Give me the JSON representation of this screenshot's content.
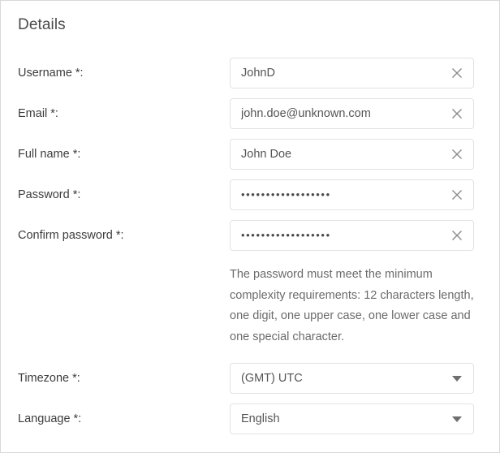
{
  "panel": {
    "title": "Details"
  },
  "form": {
    "fields": [
      {
        "label": "Username *:",
        "type": "text",
        "value": "JohnD",
        "clear_icon": "close-icon"
      },
      {
        "label": "Email *:",
        "type": "text",
        "value": "john.doe@unknown.com",
        "clear_icon": "close-icon"
      },
      {
        "label": "Full name *:",
        "type": "text",
        "value": "John Doe",
        "clear_icon": "close-icon"
      },
      {
        "label": "Password *:",
        "type": "password",
        "value": "••••••••••••••••••",
        "clear_icon": "close-icon"
      },
      {
        "label": "Confirm password *:",
        "type": "password",
        "value": "••••••••••••••••••",
        "clear_icon": "close-icon"
      }
    ],
    "password_hint": "The password must meet the minimum complexity requirements: 12 characters length, one digit, one upper case, one lower case and one special character.",
    "selects": [
      {
        "label": "Timezone *:",
        "value": "(GMT) UTC",
        "caret_icon": "chevron-down-icon"
      },
      {
        "label": "Language *:",
        "value": "English",
        "caret_icon": "chevron-down-icon"
      }
    ]
  },
  "colors": {
    "border": "#e2e2e2",
    "panel_border": "#d8d8d8",
    "label_text": "#3c3c3c",
    "value_text": "#555555",
    "hint_text": "#6b6b6b",
    "title_text": "#4a4a4a",
    "icon": "#8a8a8a",
    "caret": "#6e6e6e"
  }
}
